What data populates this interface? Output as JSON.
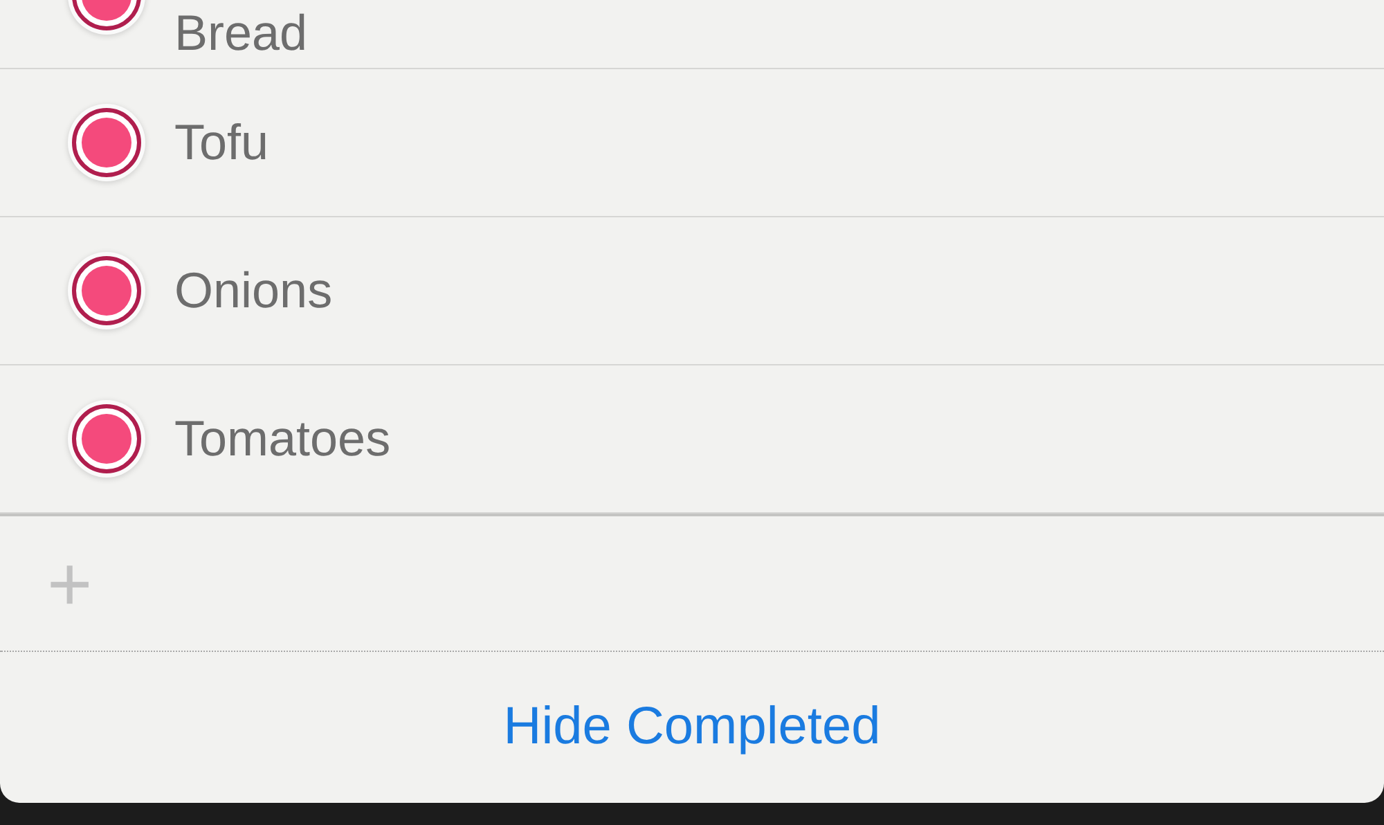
{
  "reminders": [
    {
      "title": "Bread",
      "completed": true
    },
    {
      "title": "Tofu",
      "completed": true
    },
    {
      "title": "Onions",
      "completed": true
    },
    {
      "title": "Tomatoes",
      "completed": true
    }
  ],
  "add_button": {
    "label": "+"
  },
  "footer": {
    "label": "Hide Completed"
  }
}
